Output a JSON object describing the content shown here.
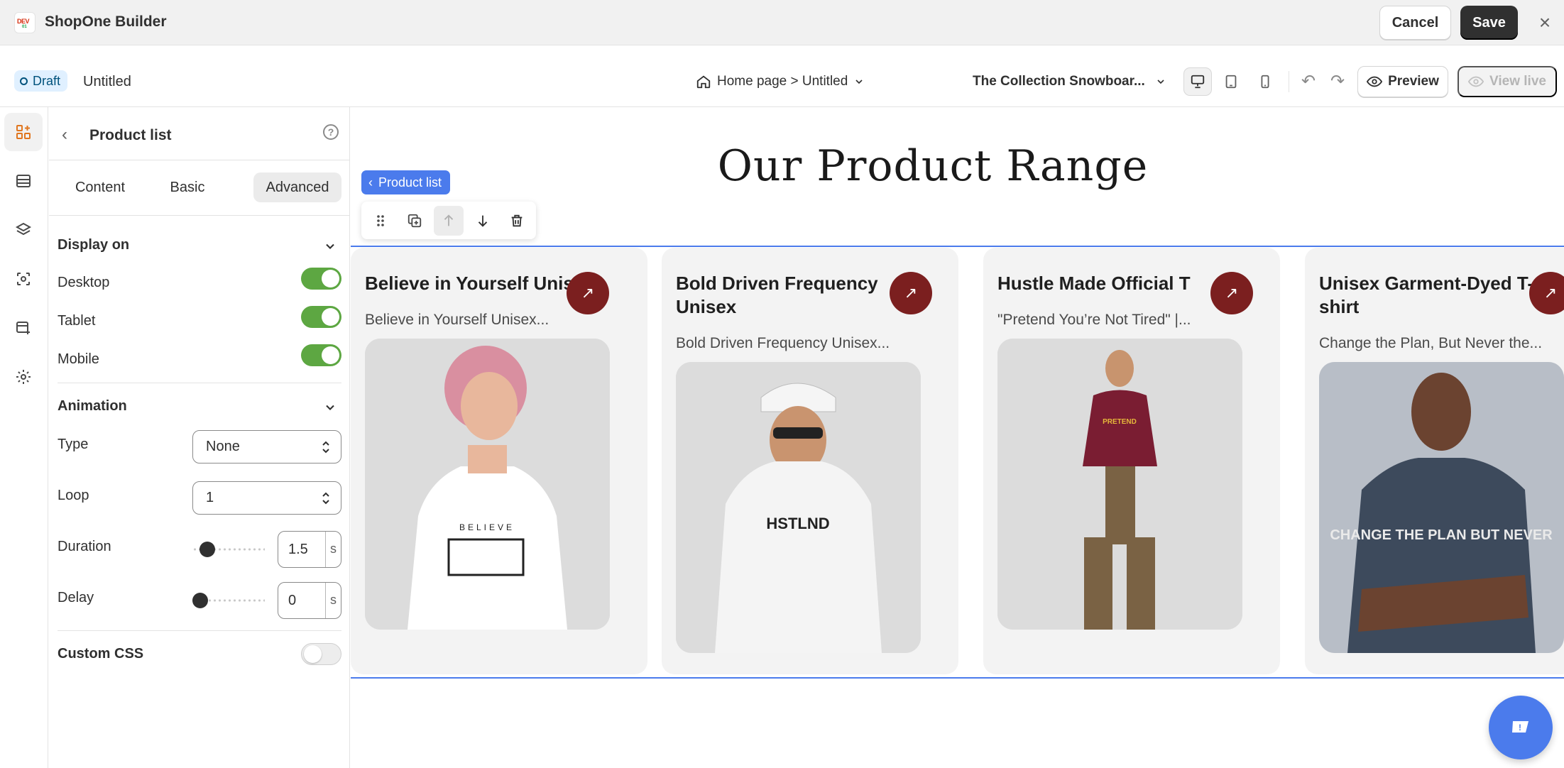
{
  "app": {
    "title": "ShopOne Builder",
    "logo_text_top": "DEV",
    "logo_text_bottom": "01",
    "cancel_label": "Cancel",
    "save_label": "Save"
  },
  "subbar": {
    "status": "Draft",
    "page_name": "Untitled",
    "page_path": "Home page > Untitled",
    "store_name": "The Collection Snowboar...",
    "preview_label": "Preview",
    "view_live_label": "View live",
    "device_active": "desktop"
  },
  "rail": {
    "items": [
      {
        "icon": "add-section-icon",
        "active": true
      },
      {
        "icon": "layout-icon",
        "active": false
      },
      {
        "icon": "layers-icon",
        "active": false
      },
      {
        "icon": "theme-icon",
        "active": false
      },
      {
        "icon": "pages-add-icon",
        "active": false
      },
      {
        "icon": "settings-gear-icon",
        "active": false
      }
    ]
  },
  "panel": {
    "title": "Product list",
    "tabs": [
      {
        "label": "Content",
        "active": false
      },
      {
        "label": "Basic",
        "active": false
      },
      {
        "label": "Advanced",
        "active": true
      }
    ],
    "display_on": {
      "heading": "Display on",
      "desktop_label": "Desktop",
      "desktop_on": true,
      "tablet_label": "Tablet",
      "tablet_on": true,
      "mobile_label": "Mobile",
      "mobile_on": true
    },
    "animation": {
      "heading": "Animation",
      "type_label": "Type",
      "type_value": "None",
      "loop_label": "Loop",
      "loop_value": "1",
      "duration_label": "Duration",
      "duration_value": "1.5",
      "duration_unit": "s",
      "delay_label": "Delay",
      "delay_value": "0",
      "delay_unit": "s"
    },
    "custom_css_label": "Custom CSS",
    "custom_css_on": false
  },
  "canvas": {
    "heading": "Our Product Range",
    "selected_chip": "Product list",
    "products": [
      {
        "title": "Believe in Yourself Unisex",
        "desc": "Believe in Yourself Unisex...",
        "shirt_color": "#ffffff",
        "print": "BELIEVE"
      },
      {
        "title": "Bold Driven Frequency Unisex",
        "desc": "Bold Driven Frequency Unisex...",
        "shirt_color": "#f4f4f4",
        "print": "HSTLND"
      },
      {
        "title": "Hustle Made Official T",
        "desc": "\"Pretend You’re Not Tired\" |...",
        "shirt_color": "#7a1d32",
        "print": "PRETEND"
      },
      {
        "title": "Unisex Garment-Dyed T-shirt",
        "desc": "Change the Plan, But Never the...",
        "shirt_color": "#3d4a5c",
        "print": "CHANGE THE PLAN BUT NEVER"
      }
    ]
  },
  "colors": {
    "accent_blue": "#4b7bec",
    "toggle_green": "#5da742",
    "card_arrow": "#7b1f1f"
  }
}
